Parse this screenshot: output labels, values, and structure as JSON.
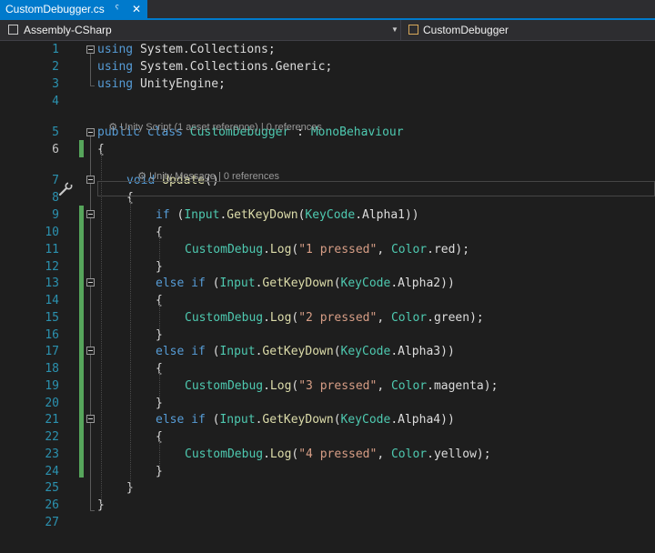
{
  "tab": {
    "title": "CustomDebugger.cs",
    "pin_icon": "pin-icon",
    "close_icon": "close-icon"
  },
  "nav": {
    "project": "Assembly-CSharp",
    "member": "CustomDebugger",
    "dropdown_icon": "chevron-down-icon"
  },
  "lens": {
    "class_lens": "Unity Script (1 asset reference) | 0 references",
    "method_lens": "Unity Message | 0 references"
  },
  "colors": {
    "keyword": "#569cd6",
    "type": "#4ec9b0",
    "method": "#dcdcaa",
    "string": "#d69d85",
    "line_number": "#2b91af",
    "change_bar": "#56a55b",
    "accent": "#007acc"
  },
  "lines": [
    {
      "n": "1",
      "tokens": [
        [
          "kw",
          "using"
        ],
        [
          "",
          "System.Collections;"
        ]
      ]
    },
    {
      "n": "2",
      "tokens": [
        [
          "kw",
          "using"
        ],
        [
          "",
          "System.Collections.Generic;"
        ]
      ]
    },
    {
      "n": "3",
      "tokens": [
        [
          "kw",
          "using"
        ],
        [
          "",
          "UnityEngine;"
        ]
      ]
    },
    {
      "n": "4",
      "tokens": []
    },
    {
      "n": "5",
      "tokens": [
        [
          "kw",
          "public"
        ],
        [
          "kw",
          "class"
        ],
        [
          "ty",
          "CustomDebugger"
        ],
        [
          "",
          ":"
        ],
        [
          "ty",
          "MonoBehaviour"
        ]
      ]
    },
    {
      "n": "6",
      "tokens": [
        [
          "",
          "{"
        ]
      ]
    },
    {
      "n": "7",
      "tokens": [
        [
          "kw",
          "void"
        ],
        [
          "fn",
          "Update"
        ],
        [
          "",
          "()"
        ]
      ]
    },
    {
      "n": "8",
      "tokens": [
        [
          "",
          "{"
        ]
      ]
    },
    {
      "n": "9",
      "tokens": [
        [
          "kw",
          "if"
        ],
        [
          "",
          "("
        ],
        [
          "ty",
          "Input"
        ],
        [
          "",
          "."
        ],
        [
          "fn",
          "GetKeyDown"
        ],
        [
          "",
          "("
        ],
        [
          "ty",
          "KeyCode"
        ],
        [
          "",
          ".Alpha1))"
        ]
      ]
    },
    {
      "n": "10",
      "tokens": [
        [
          "",
          "{"
        ]
      ]
    },
    {
      "n": "11",
      "tokens": [
        [
          "ty",
          "CustomDebug"
        ],
        [
          "",
          "."
        ],
        [
          "fn",
          "Log"
        ],
        [
          "",
          "("
        ],
        [
          "st",
          "\"1 pressed\""
        ],
        [
          "",
          ", "
        ],
        [
          "ty",
          "Color"
        ],
        [
          "",
          ".red);"
        ]
      ]
    },
    {
      "n": "12",
      "tokens": [
        [
          "",
          "}"
        ]
      ]
    },
    {
      "n": "13",
      "tokens": [
        [
          "kw",
          "else"
        ],
        [
          "kw",
          "if"
        ],
        [
          "",
          "("
        ],
        [
          "ty",
          "Input"
        ],
        [
          "",
          "."
        ],
        [
          "fn",
          "GetKeyDown"
        ],
        [
          "",
          "("
        ],
        [
          "ty",
          "KeyCode"
        ],
        [
          "",
          ".Alpha2))"
        ]
      ]
    },
    {
      "n": "14",
      "tokens": [
        [
          "",
          "{"
        ]
      ]
    },
    {
      "n": "15",
      "tokens": [
        [
          "ty",
          "CustomDebug"
        ],
        [
          "",
          "."
        ],
        [
          "fn",
          "Log"
        ],
        [
          "",
          "("
        ],
        [
          "st",
          "\"2 pressed\""
        ],
        [
          "",
          ", "
        ],
        [
          "ty",
          "Color"
        ],
        [
          "",
          ".green);"
        ]
      ]
    },
    {
      "n": "16",
      "tokens": [
        [
          "",
          "}"
        ]
      ]
    },
    {
      "n": "17",
      "tokens": [
        [
          "kw",
          "else"
        ],
        [
          "kw",
          "if"
        ],
        [
          "",
          "("
        ],
        [
          "ty",
          "Input"
        ],
        [
          "",
          "."
        ],
        [
          "fn",
          "GetKeyDown"
        ],
        [
          "",
          "("
        ],
        [
          "ty",
          "KeyCode"
        ],
        [
          "",
          ".Alpha3))"
        ]
      ]
    },
    {
      "n": "18",
      "tokens": [
        [
          "",
          "{"
        ]
      ]
    },
    {
      "n": "19",
      "tokens": [
        [
          "ty",
          "CustomDebug"
        ],
        [
          "",
          "."
        ],
        [
          "fn",
          "Log"
        ],
        [
          "",
          "("
        ],
        [
          "st",
          "\"3 pressed\""
        ],
        [
          "",
          ", "
        ],
        [
          "ty",
          "Color"
        ],
        [
          "",
          ".magenta);"
        ]
      ]
    },
    {
      "n": "20",
      "tokens": [
        [
          "",
          "}"
        ]
      ]
    },
    {
      "n": "21",
      "tokens": [
        [
          "kw",
          "else"
        ],
        [
          "kw",
          "if"
        ],
        [
          "",
          "("
        ],
        [
          "ty",
          "Input"
        ],
        [
          "",
          "."
        ],
        [
          "fn",
          "GetKeyDown"
        ],
        [
          "",
          "("
        ],
        [
          "ty",
          "KeyCode"
        ],
        [
          "",
          ".Alpha4))"
        ]
      ]
    },
    {
      "n": "22",
      "tokens": [
        [
          "",
          "{"
        ]
      ]
    },
    {
      "n": "23",
      "tokens": [
        [
          "ty",
          "CustomDebug"
        ],
        [
          "",
          "."
        ],
        [
          "fn",
          "Log"
        ],
        [
          "",
          "("
        ],
        [
          "st",
          "\"4 pressed\""
        ],
        [
          "",
          ", "
        ],
        [
          "ty",
          "Color"
        ],
        [
          "",
          ".yellow);"
        ]
      ]
    },
    {
      "n": "24",
      "tokens": [
        [
          "",
          "}"
        ]
      ]
    },
    {
      "n": "25",
      "tokens": [
        [
          "",
          "}"
        ]
      ]
    },
    {
      "n": "26",
      "tokens": [
        [
          "",
          "}"
        ]
      ]
    },
    {
      "n": "27",
      "tokens": []
    }
  ]
}
